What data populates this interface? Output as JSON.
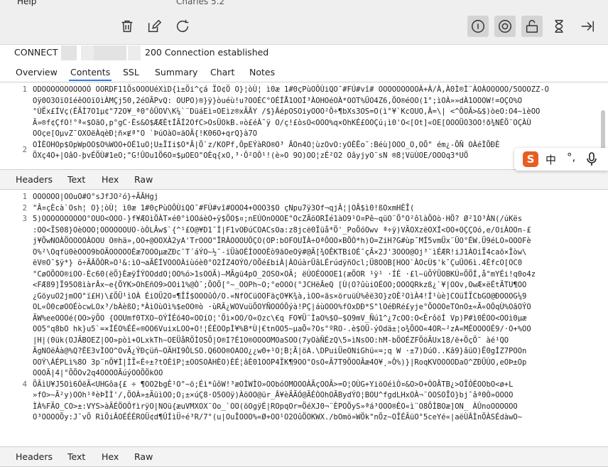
{
  "app": {
    "menu_help": "Help",
    "title": "Charles 5.2"
  },
  "toolbar": {
    "buttons": [
      {
        "name": "trash-icon"
      },
      {
        "name": "edit-icon"
      },
      {
        "name": "refresh-icon"
      },
      {
        "name": "info-icon"
      },
      {
        "name": "record-icon"
      },
      {
        "name": "lock-icon"
      },
      {
        "name": "hourglass-icon"
      },
      {
        "name": "arrow-right-bar-icon"
      }
    ]
  },
  "connect": {
    "label": "CONNECT",
    "status": "200 Connection established"
  },
  "tabs": [
    {
      "label": "Overview"
    },
    {
      "label": "Contents",
      "active": true
    },
    {
      "label": "SSL"
    },
    {
      "label": "Summary"
    },
    {
      "label": "Chart"
    },
    {
      "label": "Notes"
    }
  ],
  "request": {
    "line_numbers": [
      "1",
      "2"
    ],
    "rows": [
      "ODOOOOOOOOOOÓ OORDF11ÖsOOOUéXìD{ì±Öi^çá ÏO¢Ö O}¦òÙ¦ ì0æ    1#0çPùOÔÙiQO¯#FÚ#vî# OOOOOOOOOÀ+À/À,À0Ì®Ì¨ÀOÀOOOOO/5OOOZZ-O",
      "Oÿ0O3OïOîéêOOïOìÀMÇj50,2éOÃPvQ: OUPO)®}ÿ}òuéù!u?OOÉC°OÉÍÅ1OOÍ³ÀOHOéOÀ*OOT%ÜO4Z6,ÖO®éOO(1°;ìOÀ»»dÀ1OOOW!=OÇO%O",
      "°ÚËx£ÍVç(ÉÄÌ7O1µ¢\"72O¥_ª0°ôÜOV\\K¼`¨DüáEì¤OEìz®xÃÂY /$}ÂépOSOiyOOO²Ô÷¶bXs3OS=O(ì°¥`KcOUO,Â=\\| <^ÔOÃ>&$)òeO:O4~ìèOO",
      "Ã»®f¢ÇfO!°ª«$OãO,p°gC·Ès&O$ÆÆÈtÍÃÍ2OfC>OsÜOkB.¤ò£éÀ¯ÿ O/ç!£òsO<OOO%q×OhKÉ£OOÇú¡ì0'O<[Ot]«OE[OOOÜO3OO!ð¾NÉÖ¨OÇÀÙ",
      "OOçe[OµvZ¯OXOëÀqèÐ¦ñ×Ɇª°O `ÞúOàO¤äOÄ{!K06O+qrQ}à7O",
      "OÌÈOHOp$OpWpOO$O%WOO+OÉ1uO¦U±ÏIi$O*Â|Ö`z/KOPf,ÔpEÝàRO®O³    ÂOn4O¦ùzOvO:yOÈÊo¯:Béù]OOO_O,OÕ\" ém¿-ÕÑ OÀéÌÕÐÈ",
      "ÕXç4O+|OâO-þvÉÖÙ#1eO;\"G!ÛOu1Ö6O¤$µOEO\"OÈq{xO,³·Ô²OÔ¹!(è»O 9O)OO¦zÉ²O2 OâyjyO¨sN ®8¦VüÙOE/OOOq3*UÕ"
    ]
  },
  "subtabs_top": [
    {
      "label": "Headers"
    },
    {
      "label": "Text"
    },
    {
      "label": "Hex"
    },
    {
      "label": "Raw"
    }
  ],
  "ime": {
    "logo": "S",
    "mode": "中",
    "punct": "°,"
  },
  "response": {
    "line_numbers": [
      "1",
      "2",
      "3",
      "4"
    ],
    "rows": [
      "OOOOOO|OOuO#O°sJfJO²ó}÷ÃÂHgj",
      "\"Â¤çÈcà`Osh¦ O}¦òÙ¦ ì0æ 1#0çPùOÔÙiQO¯#FÚ#vî#OOO4+OOO3$O çNpu7ÿ3Of¬qjÂ¦|OÂ$ì0!ßOxmHÈÎ(",
      "5)OOOOOOOOOO°OUO<OOO-}f¥ÆOìÖÀT×é0°ìOOáèO+ÿ$ÖO$¤;nEÚOnOOOE\"OcZÃöORÍé1àO9¹O¤Pê~qüO¨Ö°O²ôlàÖOò·HÖ? Ø²1O³ÀN(/úKës",
      ":OO<ÏS08}OèOOO¦OOOOOOUO-òÒLÂw$`{^¹£O@¥D1¯Ì|F1vOÐúCOACsOa:z8jcë0Ïüå*Ö'_PoÖóOwv ª÷ÿ)VÃOXzëOXÍ<OO+OÇÇOó,e/OiÀOOn-£",
      "j¥ÕwNOÀÖOOOOÀOOU O®hä»,OO+@OOXÀ2yA'TrOOO\"ÎRÀOOOUÔÇO(OP:bOFOUÏÀ÷OªÔOO×BÖÒ*h)O=ZiH?G#ùp¯MÍ5vmÜx¨ÜO°ÉW.Ü9éLO»OOOFè",
      "O%²\\Oqfü0èOOO9bOÄOOOOOÉæ7OOOµæZÐc¯T´áÝO~½¯-ïÜàOÉÍOOOÈò9ãOeOÿ#@Ã[¾OÊKTBiOÉ¯çÃ×2J'3OOO@Oj³¨ìÉÆR!iJ1ÀOiÏ4caõ×Îòw\\",
      "ëV®O¯$ÿ*} ö÷ÃÂÖÒR»O¹&:ìO¬aÃÉÍVOOOÀiùóè0°O2ÍZ4OÝO/OÕé£biÀ|ÀOúàrÜâLÉrúdÿñOcl;Ü8OOB[HOO`ÀOcÙ$'k¯ÇuÛO6ì.4ÈfcO[OC0",
      "°CøOÖOO®iOO-Èc60(ëÖ}ÈæÿÍÝOOddO¦OO%ó>1sOOÃ)—MÃgü4pO_2OSO×OÃ;   ëÚOÉOOOE1(æÕOR ¹ÿ¹ ·ÍÉ ·£l~üÕÝÜOBKÚ¤ÕÖÍ,å°mYÉi!q0o4z",
      "<FÆ89]Ï95O8ìàrÂx~e{ÕYK>OhEñO9>OOi1%@Ò¯;ÕOÕ[°~_OOPh~O;°eOOO(°JCHëÂeQ [Ù(O?ûùiOÉOO;OOOQRkzß¿`¥|OOv,OwÆ×ëÉtÄTU¶OO",
      "¿GöyuO2jmOO°ï£H)\\£ÕÜ¹ìOÀ  ÉiOÜ2O¤¶ÎÍ$OOOûÓ/O.«NfOCüOOFäçO¥K¾à,ìOO«ãs×öruüÙ%êë3O}zOÈ²OìÀ4!Í¹ùè]COüÍÏCbGO@ÐOOOG¼9",
      "OL«Ò0cøOOÉòcwLOx³/bÀèßO;*ÀìOùOì%$eOO®ò ·ùRÃ¿WOVuüÕOYÑOOÓÔýà!PÇ|áùOOO%fOxDÐ*S\"lOéÐRé£yje°ÕOOOeTOnO±«Ã«OÔqÙ%OâOÝO",
      "ÃW%eeOOOé(OO>ÿÕO {OOUmf0TXO~OÝÍÉõ4O«OOíO¦'Öì×OO/O«Ozc\\€q FO¥Ü¨ÌaO%$O~$O9mV_Ñú1^¿7cOO:O<ÈrôöÍ Vp)P#ì0ÉOO<OOì0µæ",
      "OO5\"q8bO hk}u5`=×ÍÉO%ÉÉ«®OO6VuixLOO+O!¦ÉÉOOpÌ¥%B*Ù|€tnOO5~µaÕ«?Os°ºRO-.è$OÜ-ýOdä±¦o¾ÕOO«4OR~²zA«MÉOOOOÉ9/·O+%OO",
      "|H|(0ük(OJÃBOEZ|OO»pòì+OLxkTh~OEÜåRÖÌOSÕ|O®I?É1O®OOOOMOaSOO(7yOàÑÉzQ\\5»ìNsOO:hM-bÖOÉZFÖöÃUx18/ë+ÖçÖ¯ àé¹QO",
      "ÄgNOëÁà@%Q?ÈE3vÌOO^OvÃ¿ÝÐçüñ~OÄHI9ÔLSO.Q6OO®OAOO¿¿w0+¹O¦B¦Ã|öA.\\DPuiÜeONiGhü«=;q W ·±7)DúO..Kâ9}âüO)Ë0gÍZ7POOn",
      "OOÝ\\ÁÉPLì%8O 3p¨nÕ¥Ì|ÌÏ«É÷±?tOÉîP¦±OOSOÀHÈO)ÈÉ¦âÈ01OOP4ÏK¶9OO°OsO«Ã7T9ÖOOÃæ4O¥¸»Ô%)}|RoqKVOOOODaO^ZÐÜÙO,eOÞ±Op",
      "OOOÃ|4|°ÕÖOv2q4OOOOÃúýOOÖÖkOO",
      "ÕÃìU¥J5Oì6ÓëÃ<UHGôa{£ ÷ ¶OO2bgÈ¹O°~ö;Éì*ûôW!³æOÌWÌO»OObóOMOOOÀÃçOOÃ>=O¦OÙG+YiöOéìÒ¤&O>O+ÒOÂTB¿>OÏÓÉOObO<ø+L",
      "»fO>~Ã²y)OOh¹ªèÞÌÌ'/,ÕOÀ»±ÃüìOO;O¡±×úÇ8·O5OOÿ)ÀöOO@ür_Â¥èÄÃÓ@ÃÉÒOhOÃBydÝO¦BOU^fgdLHxOÀ¬¨OOSOÎO}bj¯âª0Ò»OOOO",
      "ÌÀ%FÄO_CO>±:VYS>àÃÉÖOÔfìrÿO|NOü{æuVMXOX¨Oo_`OO(öOgÿÉ|ROpqOr=ÖéXJ0¬¨ÈPOÖyS»ªá³OOO®ÉO«ì¨O8ÕÌBOæ]ON_ ÀÛnoOOOOOO",
      "O³OOOOÕy:J¯vÕ RìÖiÂOÉÉÉROÜ¢d¶ÛÍìÜ÷é³R/7°(u|OuÎOOO%«Ø+OO¹O2OûÖOKWX./bOmö»WÖk\"nÖz~OÎÉÃüO°5ceYé«|aëÙÂÌnÖÀSÉdàwO~"
    ],
    "line_number_rows": [
      0,
      1,
      2,
      17
    ]
  },
  "subtabs_bottom": [
    {
      "label": "Headers"
    },
    {
      "label": "Text"
    },
    {
      "label": "Hex"
    },
    {
      "label": "Raw"
    }
  ]
}
